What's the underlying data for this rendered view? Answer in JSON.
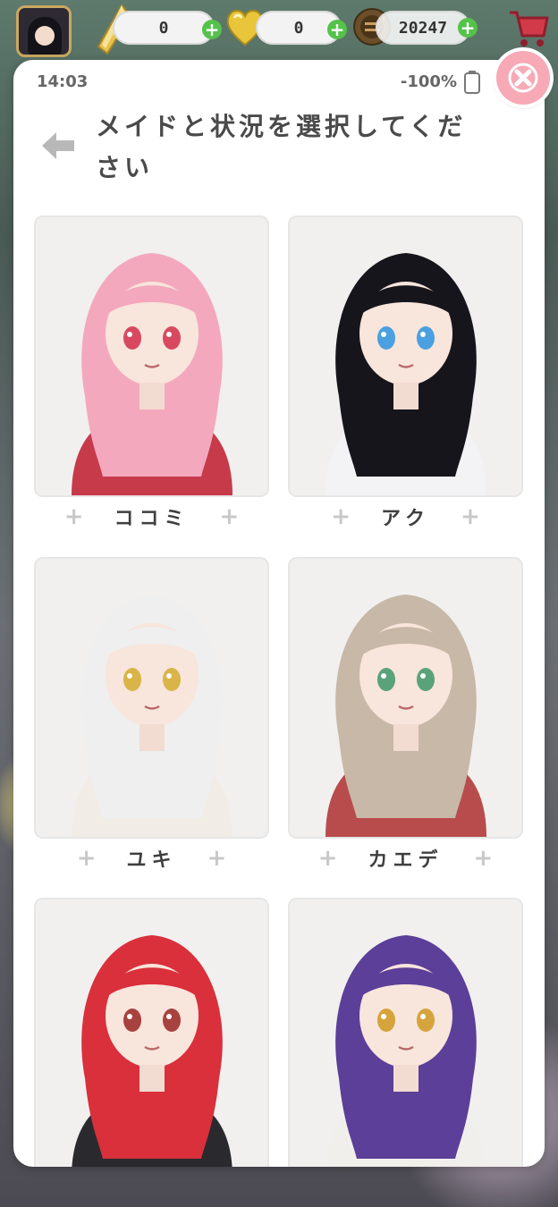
{
  "topbar": {
    "crystal_count": "0",
    "heart_count": "0",
    "coin_count": "20247"
  },
  "status": {
    "time": "14:03",
    "battery": "-100%"
  },
  "dialog": {
    "title": "メイドと状況を選択してください"
  },
  "maids": [
    {
      "name": "ココミ",
      "hair": "#f4a8bd",
      "outfit": "#c73a4a",
      "eyes": "#d8495f"
    },
    {
      "name": "アク",
      "hair": "#17151c",
      "outfit": "#f3f3f6",
      "eyes": "#4aa0e0"
    },
    {
      "name": "ユキ",
      "hair": "#efefef",
      "outfit": "#f1ede6",
      "eyes": "#d9b448"
    },
    {
      "name": "カエデ",
      "hair": "#c8b8a7",
      "outfit": "#b84c4c",
      "eyes": "#5aa27a"
    },
    {
      "name": "",
      "hair": "#d9303c",
      "outfit": "#2a2a2e",
      "eyes": "#a8423e"
    },
    {
      "name": "",
      "hair": "#5b3f98",
      "outfit": "#f1efec",
      "eyes": "#d6a43c"
    }
  ],
  "colors": {
    "accent_green": "#55c24a",
    "close_pink": "#f7a9b5",
    "title_gray": "#4a4a4a"
  }
}
